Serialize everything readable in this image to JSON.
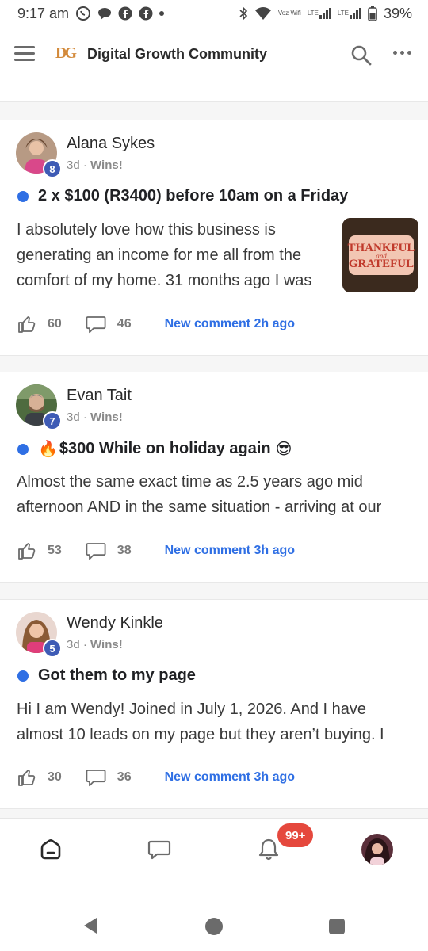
{
  "status_bar": {
    "time": "9:17 am",
    "battery": "39%",
    "network_small": "Voz Wifi",
    "lte1": "LTE",
    "lte2": "LTE"
  },
  "header": {
    "logo_text": "DG",
    "title": "Digital Growth Community"
  },
  "posts": [
    {
      "author": "Alana Sykes",
      "level": "8",
      "time": "3d",
      "category": "Wins!",
      "title": "2 x $100 (R3400) before 10am on a Friday",
      "body": [
        "I absolutely love how this business is",
        "generating an income for me all from the",
        "comfort of my home. 31 months ago I was"
      ],
      "thumb_text_1": "THANKFUL",
      "thumb_text_2": "and",
      "thumb_text_3": "GRATEFUL",
      "likes": "60",
      "comments": "46",
      "new_comment": "New comment 2h ago"
    },
    {
      "author": "Evan Tait",
      "level": "7",
      "time": "3d",
      "category": "Wins!",
      "title_prefix_emoji": "🔥",
      "title": "$300 While on holiday again",
      "title_suffix_emoji": "😎",
      "body": [
        "Almost the same exact time as 2.5 years ago mid",
        "afternoon AND in the same situation - arriving at our"
      ],
      "likes": "53",
      "comments": "38",
      "new_comment": "New comment 3h ago"
    },
    {
      "author": "Wendy Kinkle",
      "level": "5",
      "time": "3d",
      "category": "Wins!",
      "title": "Got them to my page",
      "body": [
        "Hi I am Wendy! Joined in July 1, 2026. And I have",
        "almost 10 leads on my page but they aren’t buying. I"
      ],
      "likes": "30",
      "comments": "36",
      "new_comment": "New comment 3h ago"
    }
  ],
  "bottom_nav": {
    "notification_badge": "99+"
  },
  "colors": {
    "accent_blue": "#2f6fe4",
    "level_badge": "#3e5bb5",
    "notification_red": "#e5483d"
  }
}
